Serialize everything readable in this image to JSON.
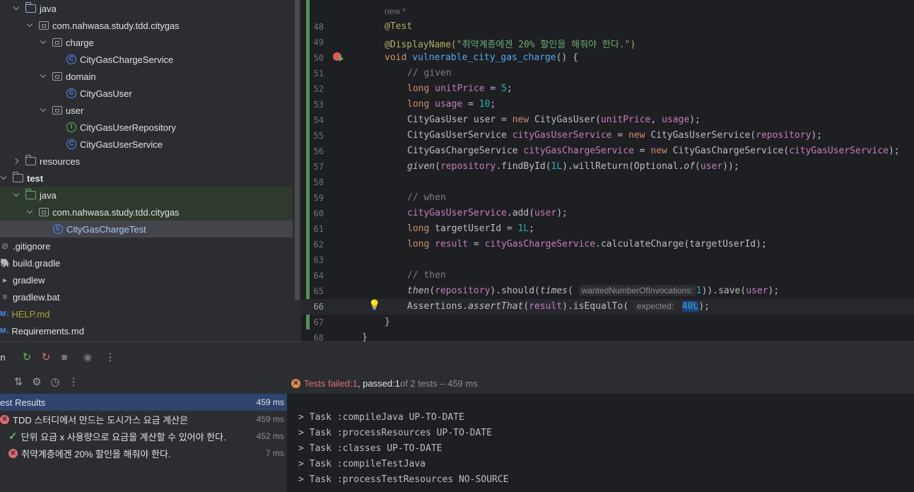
{
  "tree": {
    "items": [
      {
        "label": "java",
        "icon": "folder-icon"
      },
      {
        "label": "com.nahwasa.study.tdd.citygas",
        "icon": "package-icon"
      },
      {
        "label": "charge",
        "icon": "package-icon"
      },
      {
        "label": "CityGasChargeService",
        "icon": "class-icon"
      },
      {
        "label": "domain",
        "icon": "package-icon"
      },
      {
        "label": "CityGasUser",
        "icon": "class-icon"
      },
      {
        "label": "user",
        "icon": "package-icon"
      },
      {
        "label": "CityGasUserRepository",
        "icon": "interface-icon"
      },
      {
        "label": "CityGasUserService",
        "icon": "class-icon"
      },
      {
        "label": "resources",
        "icon": "folder-icon"
      },
      {
        "label": "test",
        "icon": "folder-icon"
      },
      {
        "label": "java",
        "icon": "folder-icon"
      },
      {
        "label": "com.nahwasa.study.tdd.citygas",
        "icon": "package-icon"
      },
      {
        "label": "CityGasChargeTest",
        "icon": "class-icon"
      },
      {
        "label": ".gitignore",
        "icon": "ignore-icon"
      },
      {
        "label": "build.gradle",
        "icon": "gradle-icon"
      },
      {
        "label": "gradlew",
        "icon": "terminal-icon"
      },
      {
        "label": "gradlew.bat",
        "icon": "text-file-icon"
      },
      {
        "label": "HELP.md",
        "icon": "markdown-icon"
      },
      {
        "label": "Requirements.md",
        "icon": "markdown-icon"
      }
    ]
  },
  "editor": {
    "new_hint": "new *",
    "line_numbers": [
      "48",
      "49",
      "50",
      "51",
      "52",
      "53",
      "54",
      "55",
      "56",
      "57",
      "58",
      "59",
      "60",
      "61",
      "62",
      "63",
      "64",
      "65",
      "66",
      "67",
      "68"
    ],
    "l48": "@Test",
    "l49_ann": "@DisplayName(",
    "l49_str": "\"취약계층에겐 20% 할인을 해줘야 한다.\"",
    "l49_end": ")",
    "l50_kw": "void ",
    "l50_fn": "vulnerable_city_gas_charge",
    "l50_end": "() {",
    "l51": "// given",
    "l52_kw": "long ",
    "l52_var": "unitPrice",
    "l52_eq": " = ",
    "l52_num": "5",
    "l52_end": ";",
    "l53_kw": "long ",
    "l53_var": "usage",
    "l53_eq": " = ",
    "l53_num": "10",
    "l53_end": ";",
    "l54_a": "CityGasUser user = ",
    "l54_kw": "new ",
    "l54_b": "CityGasUser(",
    "l54_f1": "unitPrice",
    "l54_c": ", ",
    "l54_f2": "usage",
    "l54_d": ");",
    "l55_a": "CityGasUserService ",
    "l55_f": "cityGasUserService",
    "l55_eq": " = ",
    "l55_kw": "new ",
    "l55_b": "CityGasUserService(",
    "l55_f2": "repository",
    "l55_c": ");",
    "l56_a": "CityGasChargeService ",
    "l56_f": "cityGasChargeService",
    "l56_eq": " = ",
    "l56_kw": "new ",
    "l56_b": "CityGasChargeService(",
    "l56_f2": "cityGasUserService",
    "l56_c": ");",
    "l57_fn": "given",
    "l57_a": "(",
    "l57_f": "repository",
    "l57_b": ".findById(",
    "l57_num": "1L",
    "l57_c": ").willReturn(Optional.",
    "l57_of": "of",
    "l57_d": "(",
    "l57_f2": "user",
    "l57_e": "));",
    "l59": "// when",
    "l60_f": "cityGasUserService",
    "l60_b": ".add(",
    "l60_f2": "user",
    "l60_c": ");",
    "l61_kw": "long ",
    "l61_a": "targetUserId = ",
    "l61_num": "1L",
    "l61_end": ";",
    "l62_kw": "long ",
    "l62_var": "result",
    "l62_eq": " = ",
    "l62_f": "cityGasChargeService",
    "l62_b": ".calculateCharge(targetUserId);",
    "l64": "// then",
    "l65_fn": "then",
    "l65_a": "(",
    "l65_f": "repository",
    "l65_b": ").should(",
    "l65_fn2": "times",
    "l65_c": "( ",
    "l65_hint": "wantedNumberOfInvocations:",
    "l65_num": "1",
    "l65_d": ")).save(",
    "l65_f2": "user",
    "l65_e": ");",
    "l66_a": "Assertions.",
    "l66_fn": "assertThat",
    "l66_b": "(",
    "l66_f": "result",
    "l66_c": ").isEqualTo( ",
    "l66_hint": "expected:",
    "l66_num": "40L",
    "l66_d": ");",
    "l67": "}",
    "l68": "}"
  },
  "run": {
    "status": {
      "failed_label": "Tests failed: ",
      "failed_count": "1",
      "sep": ", passed: ",
      "passed_count": "1",
      "total": " of 2 tests – 459 ms"
    },
    "tests": [
      {
        "label": "est Results",
        "time": "459 ms"
      },
      {
        "label": "TDD 스터디에서 만드는 도시가스 요금 계산은",
        "time": "459 ms"
      },
      {
        "label": "단위 요금 x 사용량으로 요금을 계산할 수 있어야 한다.",
        "time": "452 ms"
      },
      {
        "label": "취약계층에겐 20% 할인을 해줘야 한다.",
        "time": "7 ms"
      }
    ],
    "console": [
      "> Task :compileJava UP-TO-DATE",
      "> Task :processResources UP-TO-DATE",
      "> Task :classes UP-TO-DATE",
      "> Task :compileTestJava",
      "> Task :processTestResources NO-SOURCE"
    ]
  },
  "colors": {
    "accent": "#548af7",
    "failed": "#e06c75",
    "passed": "#5fb865",
    "warning": "#e88d4a"
  }
}
